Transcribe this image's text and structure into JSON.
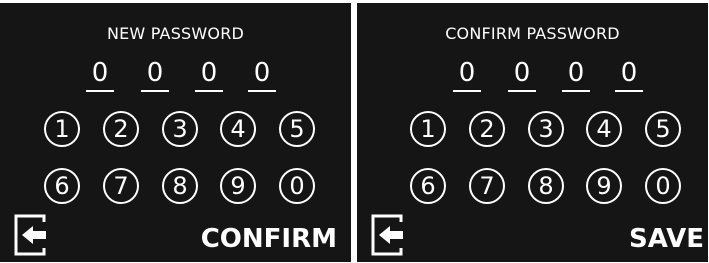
{
  "new_password": {
    "title": "NEW PASSWORD",
    "digits": [
      "0",
      "0",
      "0",
      "0"
    ],
    "keys": [
      "1",
      "2",
      "3",
      "4",
      "5",
      "6",
      "7",
      "8",
      "9",
      "0"
    ],
    "action_label": "CONFIRM",
    "back_icon": "exit-door-arrow-icon"
  },
  "confirm_password": {
    "title": "CONFIRM PASSWORD",
    "digits": [
      "0",
      "0",
      "0",
      "0"
    ],
    "keys": [
      "1",
      "2",
      "3",
      "4",
      "5",
      "6",
      "7",
      "8",
      "9",
      "0"
    ],
    "action_label": "SAVE",
    "back_icon": "exit-door-arrow-icon"
  },
  "colors": {
    "panel_background": "#151515",
    "page_background": "#ffffff",
    "foreground": "#ffffff"
  }
}
